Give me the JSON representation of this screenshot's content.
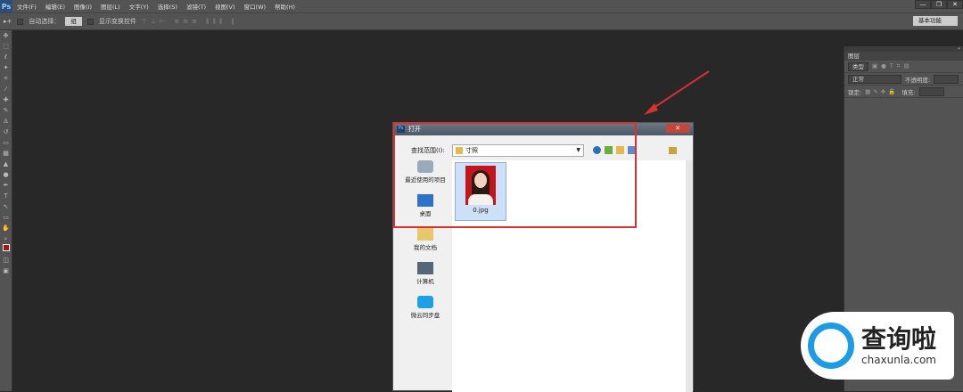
{
  "menubar": {
    "logo": "Ps",
    "items": [
      "文件(F)",
      "编辑(E)",
      "图像(I)",
      "图层(L)",
      "文字(Y)",
      "选择(S)",
      "滤镜(T)",
      "视图(V)",
      "窗口(W)",
      "帮助(H)"
    ],
    "window_buttons": [
      "—",
      "❐",
      "✕"
    ]
  },
  "options": {
    "auto_select_label": "自动选择：",
    "auto_select_value": "组",
    "show_transform_label": "显示变换控件",
    "workspace": "基本功能"
  },
  "layers_panel": {
    "tab": "图层",
    "kind": "类型",
    "blend": "正常",
    "opacity_label": "不透明度:",
    "lock_label": "锁定:",
    "fill_label": "填充:"
  },
  "dialog": {
    "title": "打开",
    "icon": "Ps",
    "close": "✕",
    "look_in_label": "查找范围(I):",
    "look_in_value": "寸照",
    "places": [
      {
        "label": "最近使用的项目",
        "icon": "recent-icon"
      },
      {
        "label": "桌面",
        "icon": "desktop-icon"
      },
      {
        "label": "我的文档",
        "icon": "documents-icon"
      },
      {
        "label": "计算机",
        "icon": "computer-icon"
      },
      {
        "label": "微云同步盘",
        "icon": "cloud-icon"
      }
    ],
    "files": [
      {
        "name": "0.jpg"
      }
    ]
  },
  "annotation_color": "#d7322e",
  "watermark": {
    "cn": "查询啦",
    "en": "chaxunla.com"
  }
}
